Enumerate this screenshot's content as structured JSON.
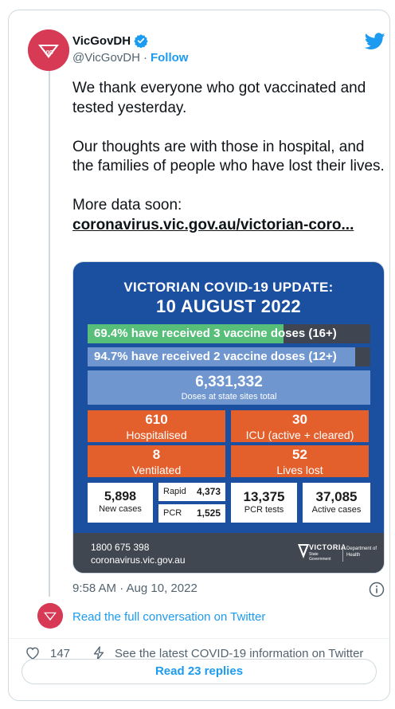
{
  "tweet": {
    "display_name": "VicGovDH",
    "handle": "@VicGovDH",
    "separator": "·",
    "follow_label": "Follow",
    "text_p1": "We thank everyone who got vaccinated and tested yesterday.",
    "text_p2": "Our thoughts are with those in hospital, and the families of people who have lost their lives.",
    "text_p3": "More data soon:",
    "link_text": "coronavirus.vic.gov.au/victorian-coro...",
    "timestamp": "9:58 AM · Aug 10, 2022",
    "read_conversation": "Read the full conversation on Twitter",
    "like_count": "147",
    "covid_info": "See the latest COVID-19 information on Twitter",
    "read_replies": "Read 23 replies",
    "avatar_text": "VIC"
  },
  "media": {
    "title": "VICTORIAN COVID-19 UPDATE:",
    "date": "10 AUGUST 2022",
    "bar1_text": "69.4% have received 3 vaccine doses (16+)",
    "bar1_fraction": 0.694,
    "bar2_text": "94.7% have received 2 vaccine doses (12+)",
    "bar2_fraction": 0.947,
    "doses_value": "6,331,332",
    "doses_label": "Doses at state sites total",
    "hospitalised_value": "610",
    "hospitalised_label": "Hospitalised",
    "icu_value": "30",
    "icu_label": "ICU (active + cleared)",
    "ventilated_value": "8",
    "ventilated_label": "Ventilated",
    "lives_lost_value": "52",
    "lives_lost_label": "Lives lost",
    "new_cases_value": "5,898",
    "new_cases_label": "New cases",
    "rapid_label": "Rapid",
    "rapid_value": "4,373",
    "pcr_label": "PCR",
    "pcr_value": "1,525",
    "pcr_tests_value": "13,375",
    "pcr_tests_label": "PCR tests",
    "active_cases_value": "37,085",
    "active_cases_label": "Active cases",
    "phone": "1800 675 398",
    "website": "coronavirus.vic.gov.au",
    "logo_word": "VICTORIA",
    "logo_sub": "State Government",
    "department": "Department of Health"
  },
  "colors": {
    "accent": "#1d9bf0",
    "avatar": "#d63a55",
    "media_bg": "#1b4fa0",
    "orange": "#e35f2c",
    "green": "#58bf7a"
  }
}
